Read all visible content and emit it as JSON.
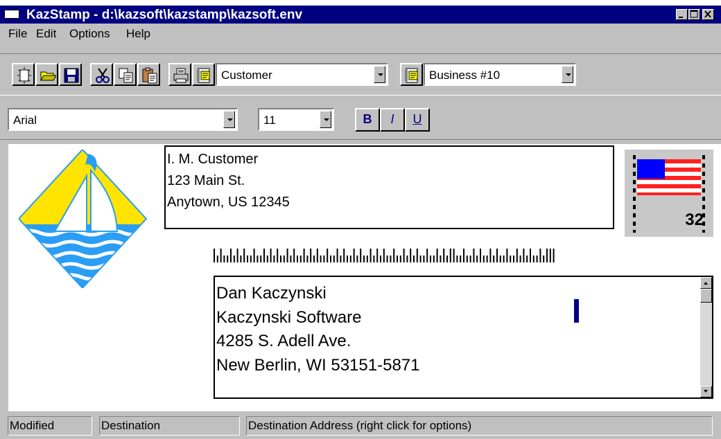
{
  "window": {
    "title": "KazStamp - d:\\kazsoft\\kazstamp\\kazsoft.env",
    "title_bar_color": "#000080"
  },
  "menu": {
    "items": [
      {
        "label": "File"
      },
      {
        "label": "Edit"
      },
      {
        "label": "Options"
      },
      {
        "label": "Help"
      }
    ]
  },
  "toolbar": {
    "buttons": [
      {
        "icon": "new-document-icon"
      },
      {
        "icon": "open-folder-icon"
      },
      {
        "icon": "save-disk-icon"
      },
      {
        "icon": "cut-scissors-icon"
      },
      {
        "icon": "copy-icon"
      },
      {
        "icon": "paste-icon"
      },
      {
        "icon": "print-icon"
      },
      {
        "icon": "address-book-icon"
      },
      {
        "icon": "envelope-setup-icon"
      }
    ],
    "address_type": "Customer",
    "envelope_size": "Business #10"
  },
  "format_bar": {
    "font_name": "Arial",
    "font_size": "11",
    "bold_label": "B",
    "italic_label": "I",
    "underline_label": "U"
  },
  "return_address": {
    "lines": [
      "I. M. Customer",
      "123 Main St.",
      "Anytown, US 12345"
    ]
  },
  "stamp": {
    "denomination": "32",
    "icon": "us-flag-stamp-icon"
  },
  "logo": {
    "icon": "sailboat-logo-icon"
  },
  "destination_address": {
    "lines": [
      "Dan Kaczynski",
      "Kaczynski Software",
      "4285 S. Adell Ave.",
      "New Berlin, WI  53151-5871"
    ]
  },
  "status": {
    "state": "Modified",
    "field": "Destination",
    "hint": "Destination Address (right click for options)"
  }
}
